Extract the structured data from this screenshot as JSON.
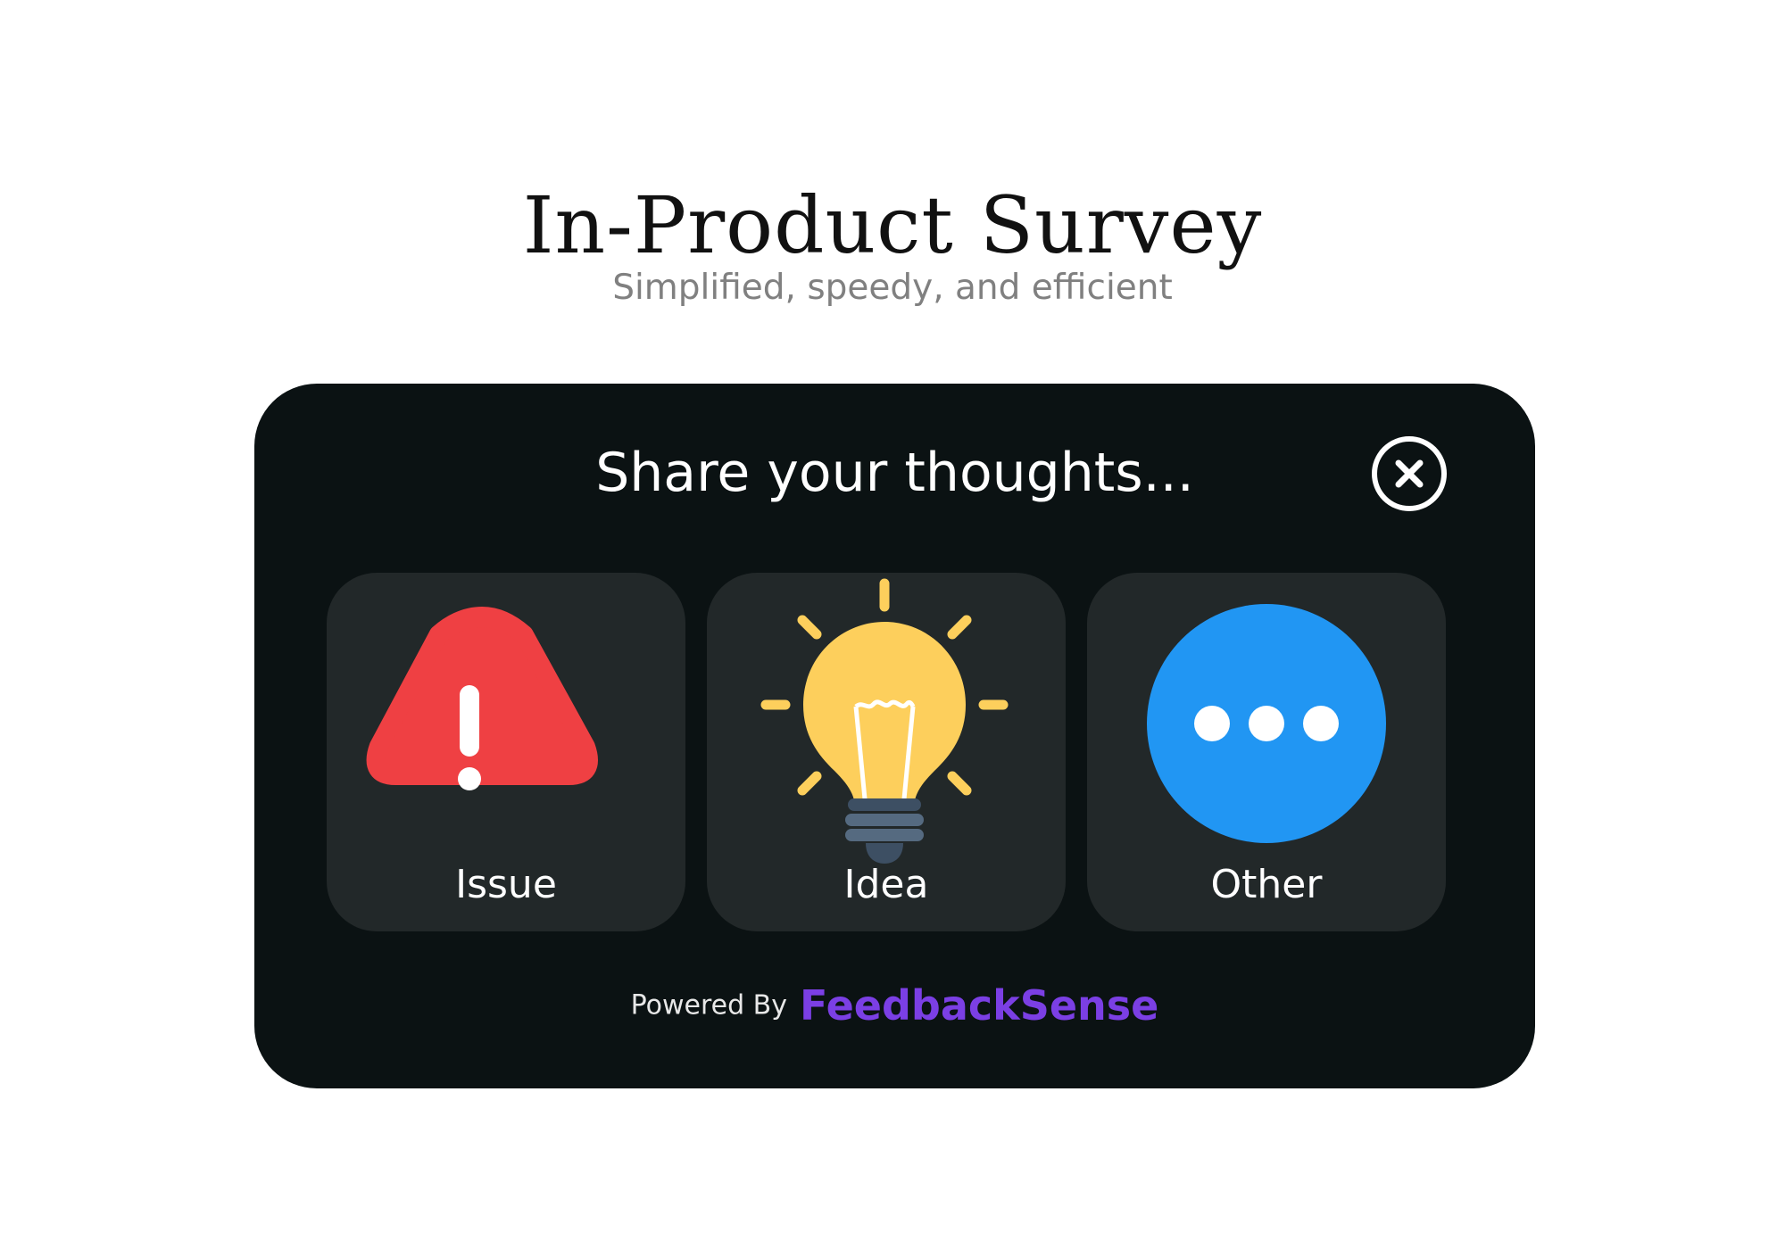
{
  "header": {
    "title": "In-Product Survey",
    "subtitle": "Simplified, speedy, and efficient"
  },
  "widget": {
    "title": "Share your thoughts...",
    "close_icon": "close-circle-icon",
    "options": [
      {
        "label": "Issue",
        "icon": "warning-triangle-icon",
        "color": "#ef4043"
      },
      {
        "label": "Idea",
        "icon": "lightbulb-icon",
        "color": "#fdcf5c"
      },
      {
        "label": "Other",
        "icon": "more-dots-icon",
        "color": "#2196f3"
      }
    ],
    "footer": {
      "powered_by": "Powered By",
      "brand": "FeedbackSense",
      "brand_color": "#7b3fe4"
    }
  }
}
